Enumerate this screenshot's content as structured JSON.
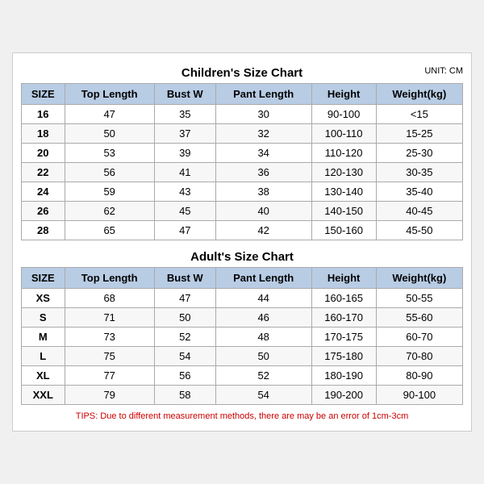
{
  "children_title": "Children's Size Chart",
  "adult_title": "Adult's Size Chart",
  "unit": "UNIT: CM",
  "columns": [
    "SIZE",
    "Top Length",
    "Bust W",
    "Pant Length",
    "Height",
    "Weight(kg)"
  ],
  "children_rows": [
    [
      "16",
      "47",
      "35",
      "30",
      "90-100",
      "<15"
    ],
    [
      "18",
      "50",
      "37",
      "32",
      "100-110",
      "15-25"
    ],
    [
      "20",
      "53",
      "39",
      "34",
      "110-120",
      "25-30"
    ],
    [
      "22",
      "56",
      "41",
      "36",
      "120-130",
      "30-35"
    ],
    [
      "24",
      "59",
      "43",
      "38",
      "130-140",
      "35-40"
    ],
    [
      "26",
      "62",
      "45",
      "40",
      "140-150",
      "40-45"
    ],
    [
      "28",
      "65",
      "47",
      "42",
      "150-160",
      "45-50"
    ]
  ],
  "adult_rows": [
    [
      "XS",
      "68",
      "47",
      "44",
      "160-165",
      "50-55"
    ],
    [
      "S",
      "71",
      "50",
      "46",
      "160-170",
      "55-60"
    ],
    [
      "M",
      "73",
      "52",
      "48",
      "170-175",
      "60-70"
    ],
    [
      "L",
      "75",
      "54",
      "50",
      "175-180",
      "70-80"
    ],
    [
      "XL",
      "77",
      "56",
      "52",
      "180-190",
      "80-90"
    ],
    [
      "XXL",
      "79",
      "58",
      "54",
      "190-200",
      "90-100"
    ]
  ],
  "tips": "TIPS: Due to different measurement methods, there are may be an error of 1cm-3cm"
}
